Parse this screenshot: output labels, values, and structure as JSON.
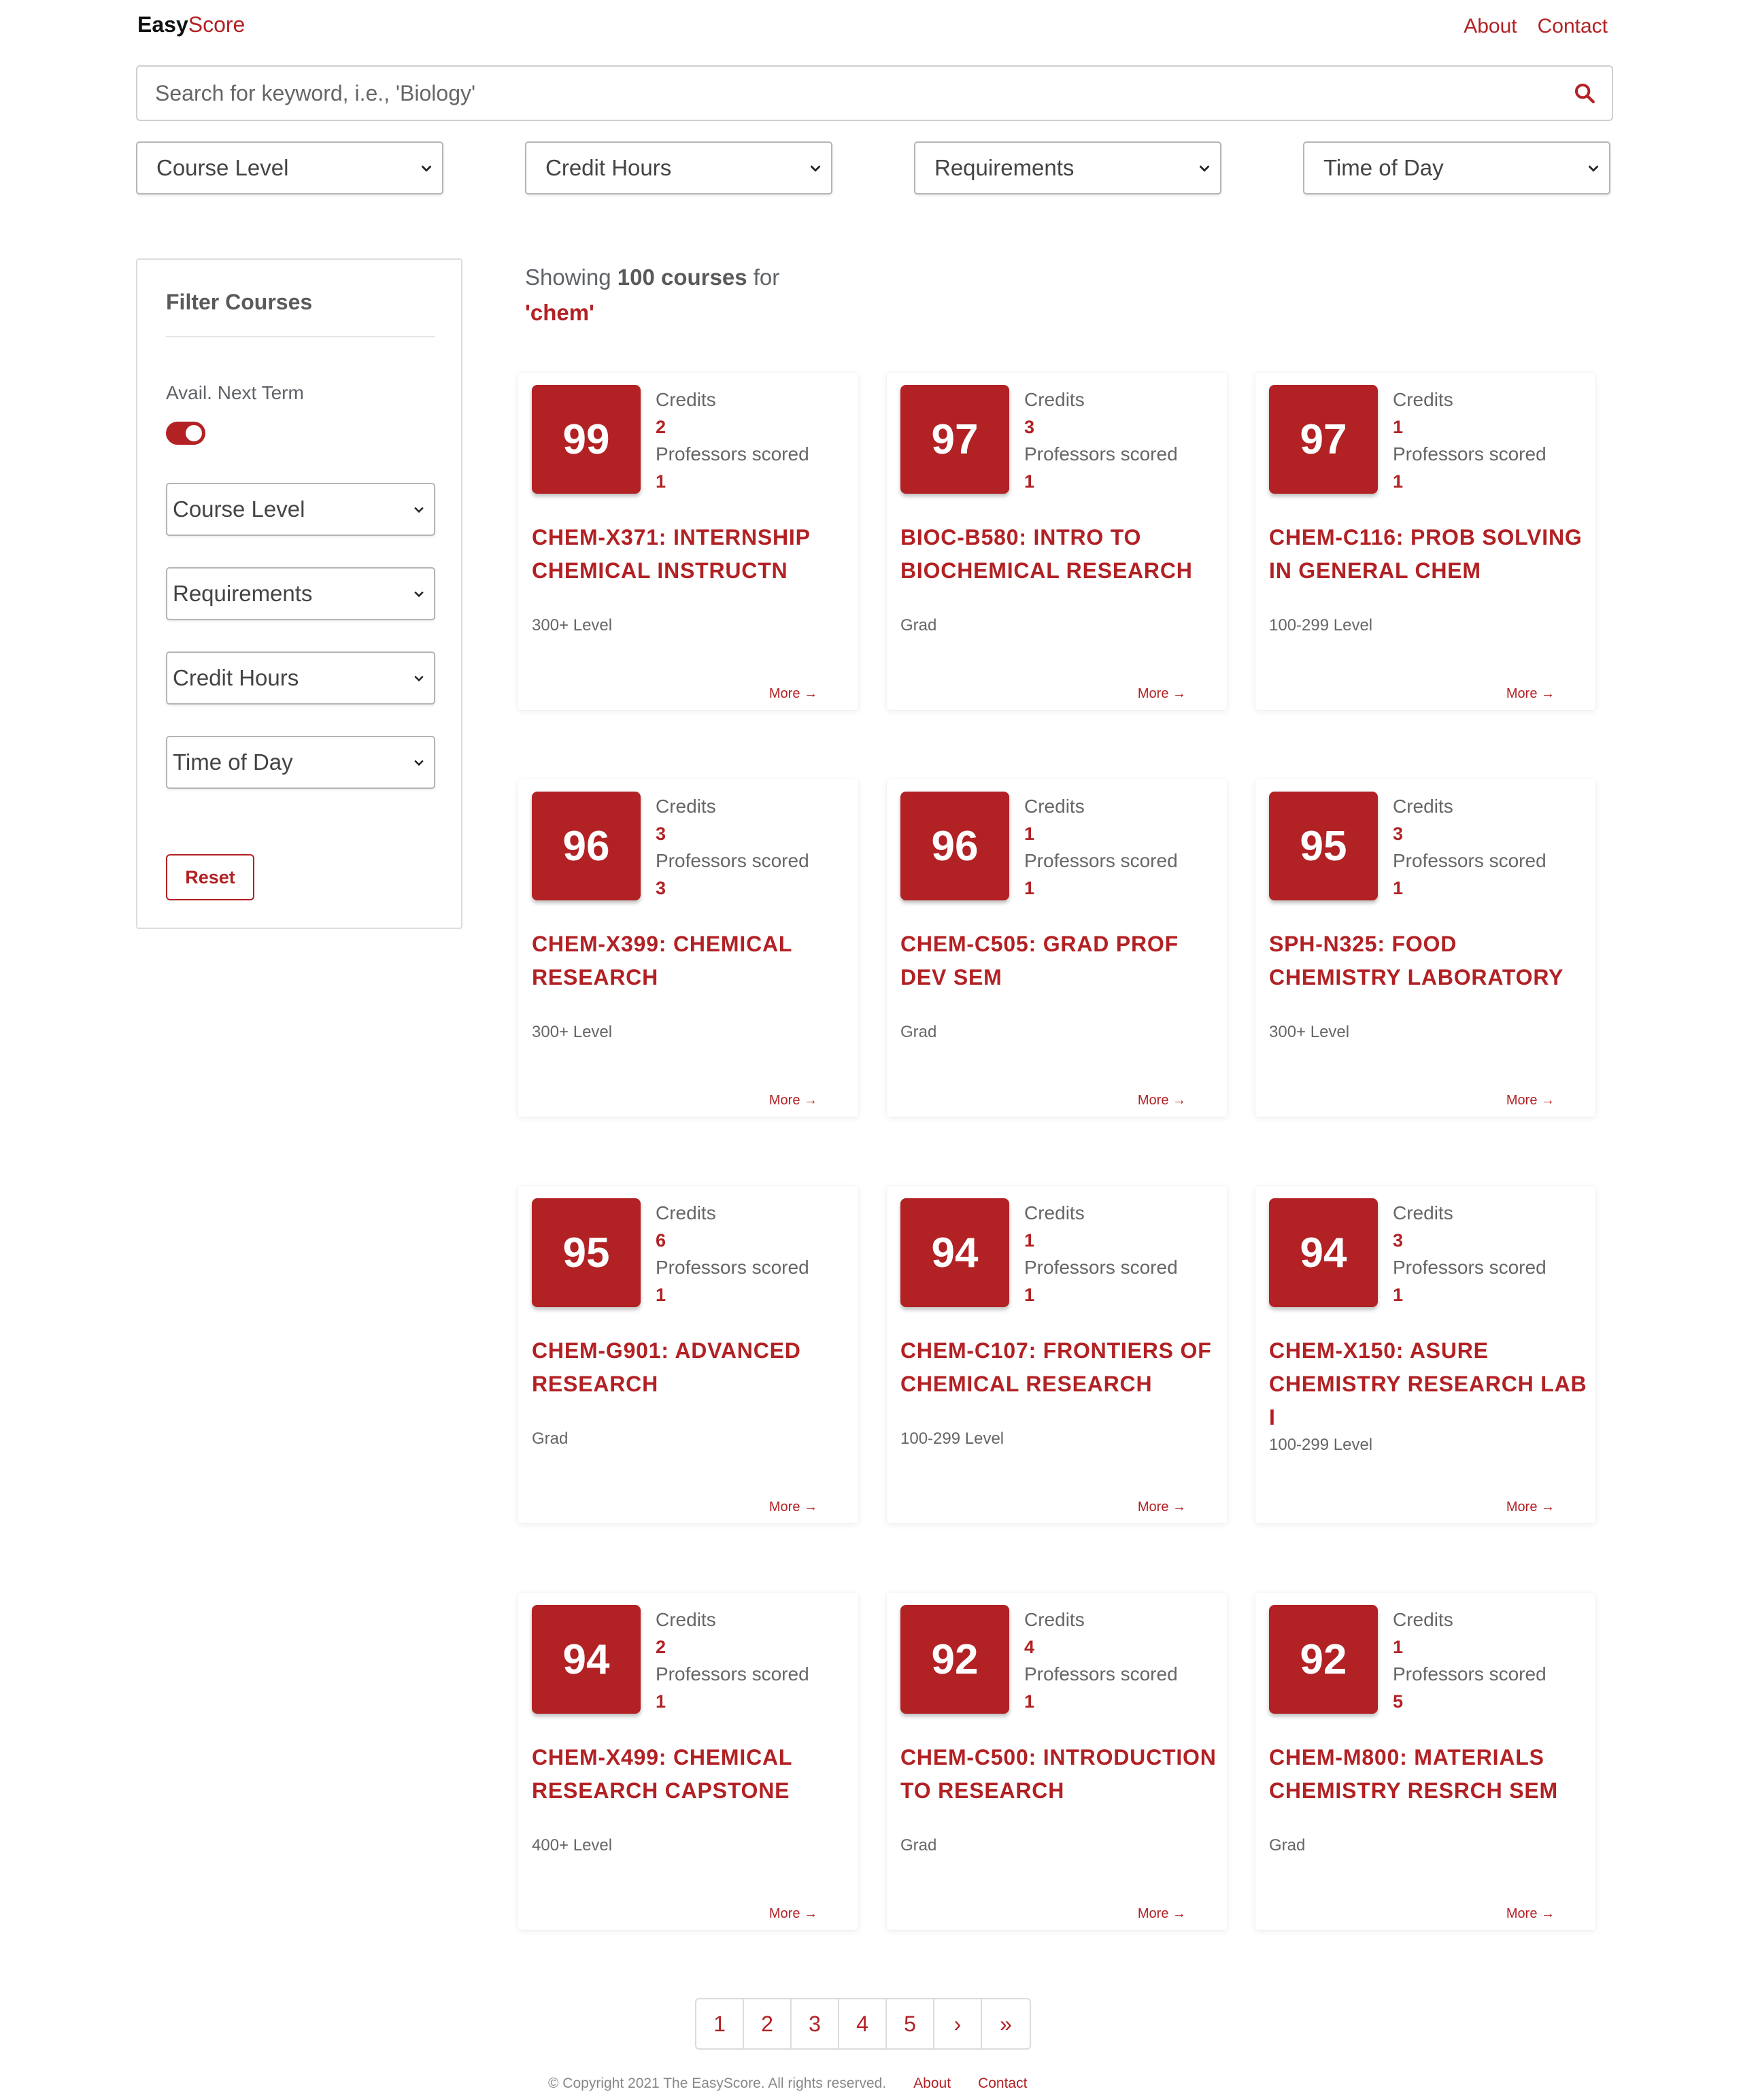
{
  "brand": {
    "bold": "Easy",
    "light": "Score"
  },
  "nav": {
    "about": "About",
    "contact": "Contact"
  },
  "search": {
    "placeholder": "Search for keyword, i.e., 'Biology'"
  },
  "top_filters": [
    "Course Level",
    "Credit Hours",
    "Requirements",
    "Time of Day"
  ],
  "sidebar": {
    "title": "Filter Courses",
    "avail_label": "Avail. Next Term",
    "selects": [
      "Course Level",
      "Requirements",
      "Credit Hours",
      "Time of Day"
    ],
    "reset": "Reset"
  },
  "results": {
    "prefix": "Showing",
    "count": "100 courses",
    "for": "for",
    "query": "'chem'"
  },
  "labels": {
    "credits": "Credits",
    "profs": "Professors scored",
    "more": "More →"
  },
  "courses": [
    {
      "score": "99",
      "credits": "2",
      "profs": "1",
      "title": "CHEM-X371: INTERNSHIP CHEMICAL INSTRUCTN",
      "level": "300+ Level"
    },
    {
      "score": "97",
      "credits": "3",
      "profs": "1",
      "title": "BIOC-B580: INTRO TO BIOCHEMICAL RESEARCH",
      "level": "Grad"
    },
    {
      "score": "97",
      "credits": "1",
      "profs": "1",
      "title": "CHEM-C116: PROB SOLVING IN GENERAL CHEM",
      "level": "100-299 Level"
    },
    {
      "score": "96",
      "credits": "3",
      "profs": "3",
      "title": "CHEM-X399: CHEMICAL RESEARCH",
      "level": "300+ Level"
    },
    {
      "score": "96",
      "credits": "1",
      "profs": "1",
      "title": "CHEM-C505: GRAD PROF DEV SEM",
      "level": "Grad"
    },
    {
      "score": "95",
      "credits": "3",
      "profs": "1",
      "title": "SPH-N325: FOOD CHEMISTRY LABORATORY",
      "level": "300+ Level"
    },
    {
      "score": "95",
      "credits": "6",
      "profs": "1",
      "title": "CHEM-G901: ADVANCED RESEARCH",
      "level": "Grad"
    },
    {
      "score": "94",
      "credits": "1",
      "profs": "1",
      "title": "CHEM-C107: FRONTIERS OF CHEMICAL RESEARCH",
      "level": "100-299 Level"
    },
    {
      "score": "94",
      "credits": "3",
      "profs": "1",
      "title": "CHEM-X150: ASURE CHEMISTRY RESEARCH LAB I",
      "level": "100-299 Level"
    },
    {
      "score": "94",
      "credits": "2",
      "profs": "1",
      "title": "CHEM-X499: CHEMICAL RESEARCH CAPSTONE",
      "level": "400+ Level"
    },
    {
      "score": "92",
      "credits": "4",
      "profs": "1",
      "title": "CHEM-C500: INTRODUCTION TO RESEARCH",
      "level": "Grad"
    },
    {
      "score": "92",
      "credits": "1",
      "profs": "5",
      "title": "CHEM-M800: MATERIALS CHEMISTRY RESRCH SEM",
      "level": "Grad"
    }
  ],
  "pagination": [
    "1",
    "2",
    "3",
    "4",
    "5",
    "›",
    "»"
  ],
  "footer": {
    "copyright": "© Copyright 2021 The EasyScore. All rights reserved.",
    "about": "About",
    "contact": "Contact"
  },
  "colors": {
    "accent": "#b22124"
  }
}
